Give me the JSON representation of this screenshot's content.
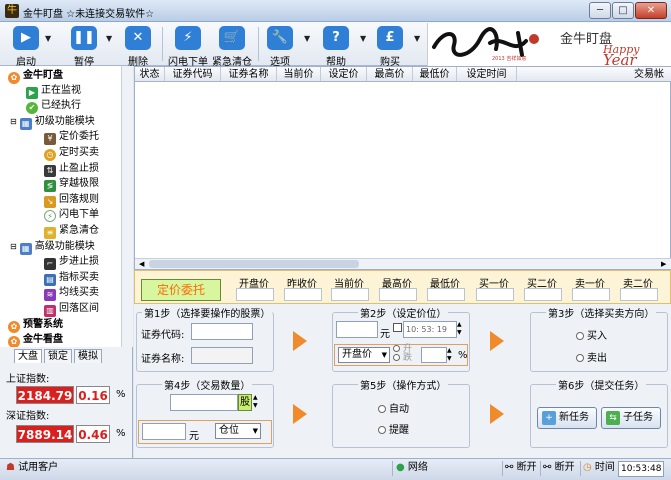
{
  "window": {
    "title": "金牛盯盘   ☆未连接交易软件☆",
    "min": "─",
    "max": "□",
    "close": "✕"
  },
  "toolbar": {
    "start": "启动",
    "pause": "暂停",
    "delete": "删除",
    "flash_order": "闪电下单",
    "emergency_clear": "紧急清仓",
    "options": "选项",
    "help": "帮助",
    "buy": "购买"
  },
  "banner": {
    "brand": "金牛盯盘",
    "happy": "Happy",
    "year": "Year",
    "calligraphy": "2013 吉祥如意",
    "colors": {
      "red": "#c0392b"
    }
  },
  "sidebar": {
    "root": "金牛盯盘",
    "monitoring": "正在监视",
    "executed": "已经执行",
    "basic": "初级功能模块",
    "limit_order": "定价委托",
    "timed_trade": "定时买卖",
    "stop_loss": "止盈止损",
    "breakout": "穿越极限",
    "pullback": "回落规则",
    "flash": "闪电下单",
    "emergency": "紧急清仓",
    "advanced": "高级功能模块",
    "step_loss": "步进止损",
    "indicator": "指标买卖",
    "ma_trade": "均线买卖",
    "drop_zone": "回落区间",
    "alert": "预警系统",
    "watch": "金牛看盘"
  },
  "index_tabs": {
    "market": "大盘",
    "lock": "锁定",
    "sim": "模拟"
  },
  "index": {
    "sh_label": "上证指数:",
    "sh_value": "2184.79",
    "sh_change": "0.16",
    "sh_pct": "%",
    "sz_label": "深证指数:",
    "sz_value": "7889.14",
    "sz_change": "0.46",
    "sz_pct": "%"
  },
  "grid": {
    "columns": [
      "状态",
      "证券代码",
      "证券名称",
      "当前价",
      "设定价",
      "最高价",
      "最低价",
      "设定时间"
    ],
    "right_col": "交易帐"
  },
  "quote": {
    "title": "定价委托",
    "headers": [
      "开盘价",
      "昨收价",
      "当前价",
      "最高价",
      "最低价",
      "买一价",
      "买二价",
      "卖一价",
      "卖二价"
    ]
  },
  "step1": {
    "title": "第1步（选择要操作的股票）",
    "code_label": "证券代码:",
    "name_label": "证券名称:"
  },
  "step2": {
    "title": "第2步（设定价位）",
    "unit": "元",
    "time": "10: 53: 19",
    "price_mode": "开盘价",
    "up": "升",
    "down": "跌",
    "pct": "%"
  },
  "step3": {
    "title": "第3步（选择买卖方向）",
    "buy": "买入",
    "sell": "卖出"
  },
  "step4": {
    "title": "第4步（交易数量）",
    "unit_share": "股",
    "unit_yuan": "元",
    "position": "仓位"
  },
  "step5": {
    "title": "第5步（操作方式）",
    "auto": "自动",
    "remind": "提醒"
  },
  "step6": {
    "title": "第6步（提交任务）",
    "new_task": "新任务",
    "sub_task": "子任务"
  },
  "status": {
    "user": "试用客户",
    "network": "网络",
    "disc1": "断开",
    "disc2": "断开",
    "time_label": "时间",
    "time": "10:53:48"
  }
}
